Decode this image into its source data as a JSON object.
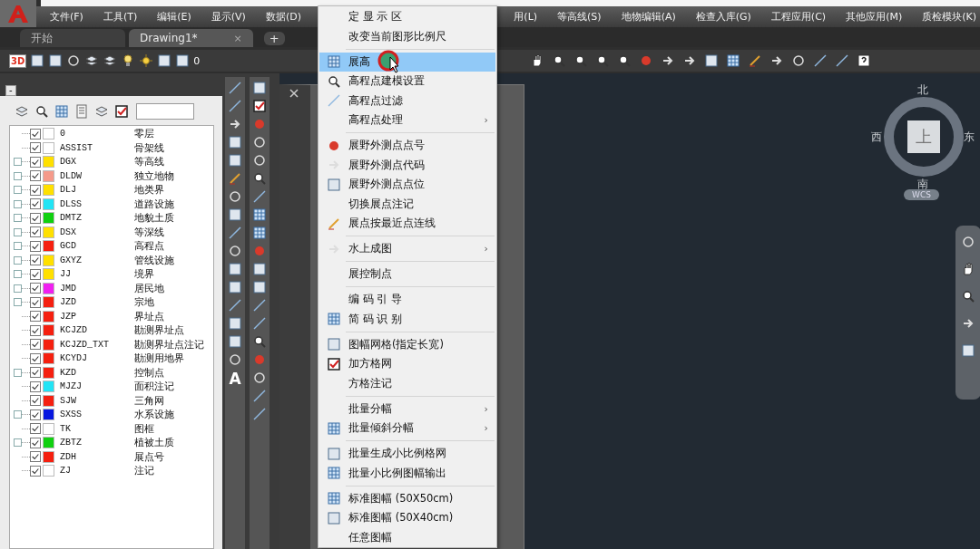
{
  "menu_bar": [
    {
      "label": "文件(F)"
    },
    {
      "label": "工具(T)"
    },
    {
      "label": "编辑(E)"
    },
    {
      "label": "显示(V)"
    },
    {
      "label": "数据(D)"
    },
    {
      "label": "用(L)"
    },
    {
      "label": "等高线(S)"
    },
    {
      "label": "地物编辑(A)"
    },
    {
      "label": "检查入库(G)"
    },
    {
      "label": "工程应用(C)"
    },
    {
      "label": "其他应用(M)"
    },
    {
      "label": "质检模块(K)"
    }
  ],
  "tabs": [
    {
      "label": "开始",
      "selected": false
    },
    {
      "label": "Drawing1*",
      "selected": true,
      "close_label": "×"
    }
  ],
  "new_tab_label": "+",
  "toolbar": {
    "view_3d_label": "3D",
    "current_layer": "0"
  },
  "layer_panel": {
    "collapse_label": "-",
    "layers": [
      {
        "name": "0",
        "description": "零层",
        "color": "#ffffff",
        "checked": true,
        "kind": "leaf"
      },
      {
        "name": "ASSIST",
        "description": "骨架线",
        "color": "#ffffff",
        "checked": true,
        "kind": "leaf"
      },
      {
        "name": "DGX",
        "description": "等高线",
        "color": "#ffe000",
        "checked": true,
        "kind": "group"
      },
      {
        "name": "DLDW",
        "description": "独立地物",
        "color": "#f59a8a",
        "checked": true,
        "kind": "group"
      },
      {
        "name": "DLJ",
        "description": "地类界",
        "color": "#ffe000",
        "checked": true,
        "kind": "group"
      },
      {
        "name": "DLSS",
        "description": "道路设施",
        "color": "#22e4f5",
        "checked": true,
        "kind": "group"
      },
      {
        "name": "DMTZ",
        "description": "地貌土质",
        "color": "#10d010",
        "checked": true,
        "kind": "group"
      },
      {
        "name": "DSX",
        "description": "等深线",
        "color": "#ffe000",
        "checked": true,
        "kind": "group"
      },
      {
        "name": "GCD",
        "description": "高程点",
        "color": "#f52010",
        "checked": true,
        "kind": "group"
      },
      {
        "name": "GXYZ",
        "description": "管线设施",
        "color": "#ffe000",
        "checked": true,
        "kind": "group"
      },
      {
        "name": "JJ",
        "description": "境界",
        "color": "#ffe000",
        "checked": true,
        "kind": "group"
      },
      {
        "name": "JMD",
        "description": "居民地",
        "color": "#f020f0",
        "checked": true,
        "kind": "group"
      },
      {
        "name": "JZD",
        "description": "宗地",
        "color": "#f52010",
        "checked": true,
        "kind": "group"
      },
      {
        "name": "JZP",
        "description": "界址点",
        "color": "#f52010",
        "checked": true,
        "kind": "leaf"
      },
      {
        "name": "KCJZD",
        "description": "勘测界址点",
        "color": "#f52010",
        "checked": true,
        "kind": "leaf"
      },
      {
        "name": "KCJZD_TXT",
        "description": "勘测界址点注记",
        "color": "#f52010",
        "checked": true,
        "kind": "leaf"
      },
      {
        "name": "KCYDJ",
        "description": "勘测用地界",
        "color": "#f52010",
        "checked": true,
        "kind": "leaf"
      },
      {
        "name": "KZD",
        "description": "控制点",
        "color": "#f52010",
        "checked": true,
        "kind": "group"
      },
      {
        "name": "MJZJ",
        "description": "面积注记",
        "color": "#22e4f5",
        "checked": true,
        "kind": "leaf"
      },
      {
        "name": "SJW",
        "description": "三角网",
        "color": "#f52010",
        "checked": true,
        "kind": "leaf"
      },
      {
        "name": "SXSS",
        "description": "水系设施",
        "color": "#0818e0",
        "checked": true,
        "kind": "group"
      },
      {
        "name": "TK",
        "description": "图框",
        "color": "#ffffff",
        "checked": true,
        "kind": "leaf"
      },
      {
        "name": "ZBTZ",
        "description": "植被土质",
        "color": "#10d010",
        "checked": true,
        "kind": "group"
      },
      {
        "name": "ZDH",
        "description": "展点号",
        "color": "#f52010",
        "checked": true,
        "kind": "leaf"
      },
      {
        "name": "ZJ",
        "description": "注记",
        "color": "#ffffff",
        "checked": true,
        "kind": "leaf"
      }
    ]
  },
  "text_tool_label": "A",
  "view_cube": {
    "top_label": "上",
    "north": "北",
    "south": "南",
    "east": "东",
    "west": "西",
    "ucs_label": "WCS"
  },
  "context_menu": [
    {
      "kind": "item",
      "label": "定 显 示 区",
      "selected": false
    },
    {
      "kind": "item",
      "label": "改变当前图形比例尺",
      "selected": false
    },
    {
      "kind": "separator"
    },
    {
      "kind": "item",
      "label": "展高",
      "selected": true
    },
    {
      "kind": "item",
      "label": "高程点建模设置",
      "selected": false
    },
    {
      "kind": "item",
      "label": "高程点过滤",
      "selected": false
    },
    {
      "kind": "submenu",
      "label": "高程点处理",
      "arrow": "›",
      "selected": false
    },
    {
      "kind": "separator"
    },
    {
      "kind": "item",
      "label": "展野外测点点号",
      "selected": false
    },
    {
      "kind": "item",
      "label": "展野外测点代码",
      "selected": false
    },
    {
      "kind": "item",
      "label": "展野外测点点位",
      "selected": false
    },
    {
      "kind": "item",
      "label": "切换展点注记",
      "selected": false
    },
    {
      "kind": "item",
      "label": "展点按最近点连线",
      "selected": false
    },
    {
      "kind": "separator"
    },
    {
      "kind": "submenu",
      "label": "水上成图",
      "arrow": "›",
      "selected": false
    },
    {
      "kind": "separator"
    },
    {
      "kind": "item",
      "label": "展控制点",
      "selected": false
    },
    {
      "kind": "separator"
    },
    {
      "kind": "item",
      "label": "编 码 引 导",
      "selected": false
    },
    {
      "kind": "item",
      "label": "简 码 识 别",
      "selected": false
    },
    {
      "kind": "separator"
    },
    {
      "kind": "item",
      "label": "图幅网格(指定长宽)",
      "selected": false
    },
    {
      "kind": "item",
      "label": "加方格网",
      "selected": false
    },
    {
      "kind": "item",
      "label": "方格注记",
      "selected": false
    },
    {
      "kind": "separator"
    },
    {
      "kind": "submenu",
      "label": "批量分幅",
      "arrow": "›",
      "selected": false
    },
    {
      "kind": "submenu",
      "label": "批量倾斜分幅",
      "arrow": "›",
      "selected": false
    },
    {
      "kind": "separator"
    },
    {
      "kind": "item",
      "label": "批量生成小比例格网",
      "selected": false
    },
    {
      "kind": "item",
      "label": "批量小比例图幅输出",
      "selected": false
    },
    {
      "kind": "separator"
    },
    {
      "kind": "item",
      "label": "标准图幅 (50X50cm)",
      "selected": false
    },
    {
      "kind": "item",
      "label": "标准图幅 (50X40cm)",
      "selected": false
    },
    {
      "kind": "item",
      "label": "任意图幅",
      "selected": false
    }
  ]
}
